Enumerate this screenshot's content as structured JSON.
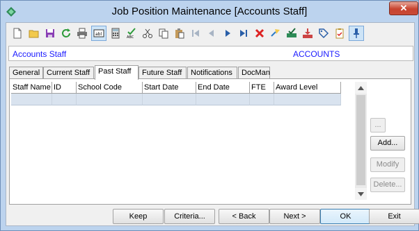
{
  "window": {
    "title": "Job Position Maintenance  [Accounts Staff]",
    "close_label": "✕"
  },
  "toolbar": {
    "icons": [
      "new-icon",
      "open-icon",
      "save-icon",
      "refresh-icon",
      "print-icon",
      "field-icon",
      "calculator-icon",
      "spellcheck-icon",
      "cut-icon",
      "copy-icon",
      "paste-icon",
      "first-record-icon",
      "previous-record-icon",
      "next-record-icon",
      "last-record-icon",
      "delete-icon",
      "goto-icon",
      "approve-icon",
      "download-icon",
      "tag-icon",
      "clipboard-check-icon",
      "pin-icon"
    ]
  },
  "infobar": {
    "left_text": "Accounts Staff",
    "right_text": "ACCOUNTS"
  },
  "tabs": [
    {
      "label": "General"
    },
    {
      "label": "Current Staff"
    },
    {
      "label": "Past Staff"
    },
    {
      "label": "Future Staff"
    },
    {
      "label": "Notifications"
    },
    {
      "label": "DocMan"
    }
  ],
  "active_tab": "Past Staff",
  "grid": {
    "columns": [
      "Staff Name",
      "ID",
      "School Code",
      "Start Date",
      "End Date",
      "FTE",
      "Award Level"
    ],
    "rows": []
  },
  "side_buttons": {
    "ellipsis": "...",
    "add": "Add...",
    "modify": "Modify",
    "delete": "Delete..."
  },
  "bottom_buttons": {
    "keep": "Keep",
    "criteria": "Criteria...",
    "back": "< Back",
    "next": "Next >",
    "ok": "OK",
    "exit": "Exit"
  }
}
